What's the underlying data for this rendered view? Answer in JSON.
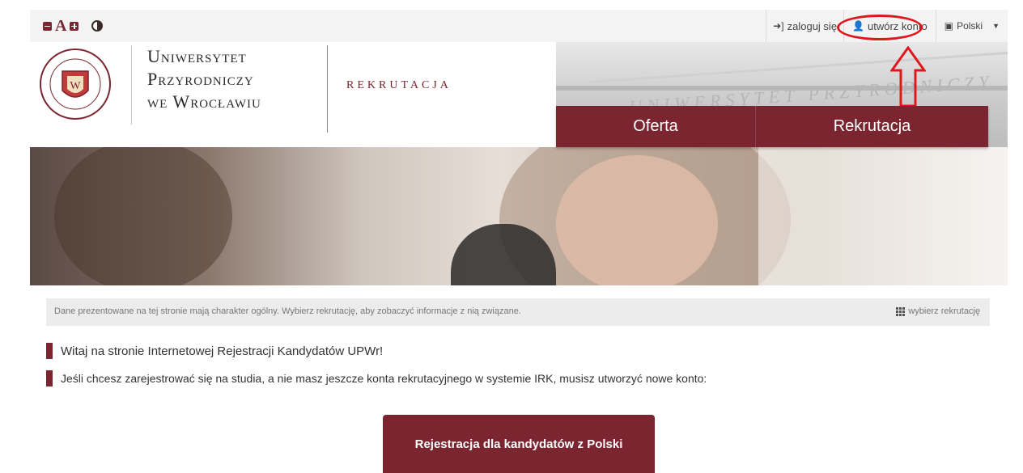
{
  "accessibility": {
    "decrease_label": "",
    "font_letter": "A",
    "increase_label": "",
    "contrast_label": ""
  },
  "account": {
    "login": "zaloguj się",
    "create": "utwórz konto",
    "language": "Polski",
    "caret": "▼"
  },
  "header": {
    "uni_line1": "Uniwersytet",
    "uni_line2": "Przyrodniczy",
    "uni_line3": "we Wrocławiu",
    "section": "REKRUTACJA",
    "building_inscription": "UNIWERSYTET PRZYRODNICZY"
  },
  "nav": {
    "offer": "Oferta",
    "recruitment": "Rekrutacja"
  },
  "info": {
    "message": "Dane prezentowane na tej stronie mają charakter ogólny. Wybierz rekrutację, aby zobaczyć informacje z nią związane.",
    "choose": "wybierz rekrutację"
  },
  "content": {
    "welcome": "Witaj na stronie Internetowej Rejestracji Kandydatów UPWr!",
    "instruction": "Jeśli chcesz zarejestrować się na studia, a nie masz jeszcze konta rekrutacyjnego w systemie IRK, musisz utworzyć nowe konto:",
    "register_button": "Rejestracja dla kandydatów z Polski"
  },
  "colors": {
    "brand": "#7a2530",
    "highlight": "#e0161c"
  }
}
